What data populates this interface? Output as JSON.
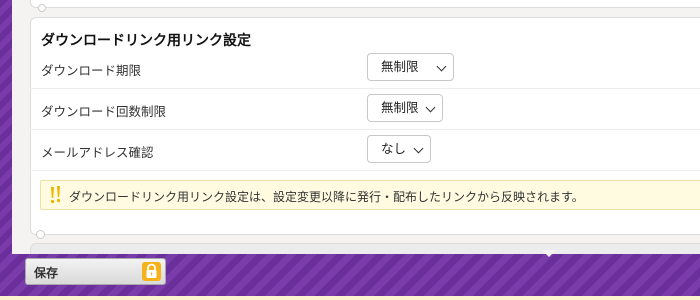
{
  "section": {
    "title": "ダウンロードリンク用リンク設定"
  },
  "settings": [
    {
      "label": "ダウンロード期限",
      "value": "無制限"
    },
    {
      "label": "ダウンロード回数制限",
      "value": "無制限"
    },
    {
      "label": "メールアドレス確認",
      "value": "なし"
    }
  ],
  "notice": {
    "text": "ダウンロードリンク用リンク設定は、設定変更以降に発行・配布したリンクから反映されます。",
    "icon": "exclamation-icon"
  },
  "footer": {
    "save_label": "保存",
    "save_icon": "lock-icon"
  },
  "colors": {
    "frame_purple": "#6a2f9a",
    "notice_bg": "#fffbe0",
    "lock_orange": "#f5b21b"
  }
}
